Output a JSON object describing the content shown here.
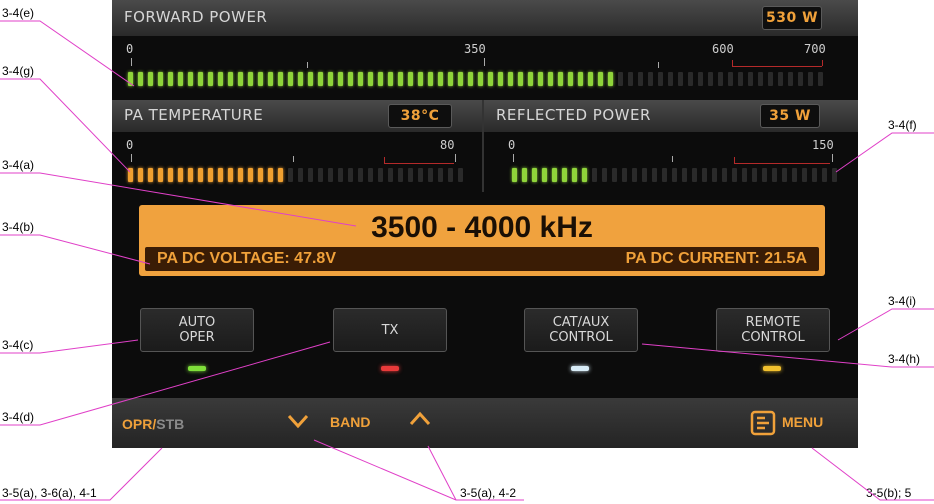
{
  "forward_power": {
    "title": "FORWARD POWER",
    "value": "530 W",
    "scale": [
      "0",
      "350",
      "600",
      "700"
    ],
    "fill_fraction": 0.7
  },
  "pa_temperature": {
    "title": "PA TEMPERATURE",
    "value": "38°C",
    "scale": [
      "0",
      "80"
    ],
    "fill_fraction": 0.48
  },
  "reflected_power": {
    "title": "REFLECTED POWER",
    "value": "35 W",
    "scale": [
      "0",
      "150"
    ],
    "fill_fraction": 0.23
  },
  "display": {
    "frequency": "3500 - 4000 kHz",
    "voltage": "PA DC VOLTAGE: 47.8V",
    "current": "PA DC CURRENT: 21.5A"
  },
  "buttons": [
    {
      "line1": "AUTO",
      "line2": "OPER",
      "led": "#7fe03a"
    },
    {
      "line1": "TX",
      "line2": "",
      "led": "#e83a3a"
    },
    {
      "line1": "CAT/AUX",
      "line2": "CONTROL",
      "led": "#d8ecf7"
    },
    {
      "line1": "REMOTE",
      "line2": "CONTROL",
      "led": "#f2c12e"
    }
  ],
  "bottom_bar": {
    "opr": "OPR",
    "slash": "/",
    "stb": "STB",
    "band": "BAND",
    "menu": "MENU"
  },
  "callouts": {
    "e": "3-4(e)",
    "g": "3-4(g)",
    "a": "3-4(a)",
    "f": "3-4(f)",
    "b": "3-4(b)",
    "c": "3-4(c)",
    "i": "3-4(i)",
    "h": "3-4(h)",
    "d": "3-4(d)",
    "opr_ref": "3-5(a), 3-6(a), 4-1",
    "band_ref": "3-5(a), 4-2",
    "menu_ref": "3-5(b); 5"
  },
  "colors": {
    "accent": "#f0a13a",
    "seg_green": "#8fd43a",
    "seg_orange": "#f0a030",
    "seg_off": "#2a2a2a",
    "leader": "#e040c8"
  }
}
